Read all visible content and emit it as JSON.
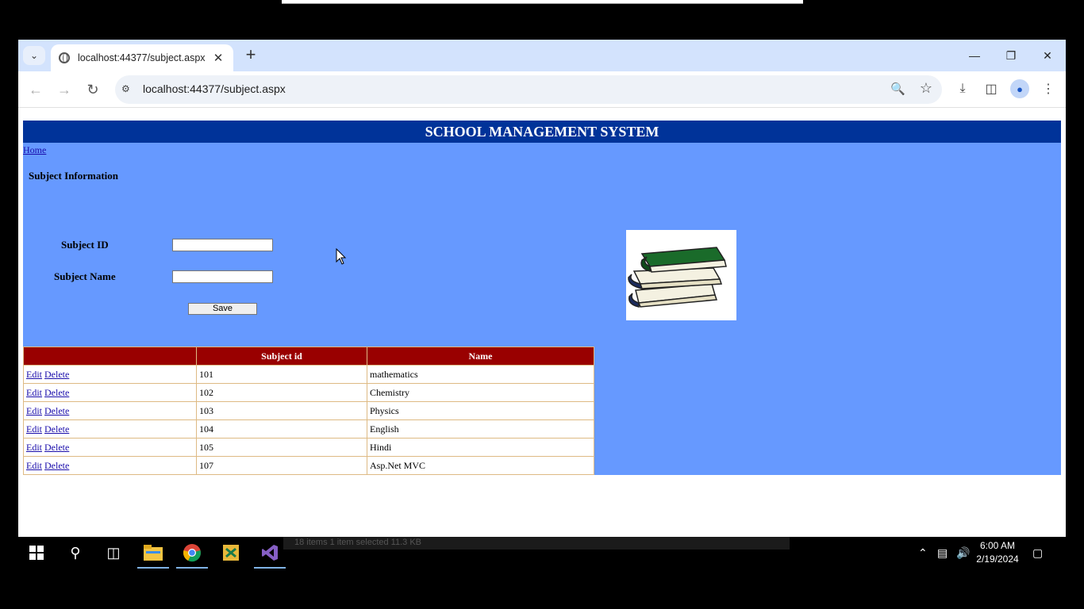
{
  "browser": {
    "tab_title": "localhost:44377/subject.aspx",
    "url": "localhost:44377/subject.aspx"
  },
  "page": {
    "header": "SCHOOL MANAGEMENT SYSTEM",
    "home_link": "Home",
    "section_title": "Subject Information",
    "form": {
      "subject_id_label": "Subject ID",
      "subject_id_value": "",
      "subject_name_label": "Subject Name",
      "subject_name_value": "",
      "save_label": "Save"
    },
    "table": {
      "headers": [
        "",
        "Subject id",
        "Name"
      ],
      "edit_label": "Edit",
      "delete_label": "Delete",
      "rows": [
        {
          "id": "101",
          "name": "mathematics"
        },
        {
          "id": "102",
          "name": "Chemistry"
        },
        {
          "id": "103",
          "name": "Physics"
        },
        {
          "id": "104",
          "name": "English"
        },
        {
          "id": "105",
          "name": "Hindi"
        },
        {
          "id": "107",
          "name": "Asp.Net MVC"
        }
      ]
    }
  },
  "taskbar": {
    "explorer_status": "18 items      1 item selected  11.3 KB",
    "time": "6:00 AM",
    "date": "2/19/2024"
  },
  "colors": {
    "header_bg": "#003399",
    "page_bg": "#6699ff",
    "grid_header_bg": "#990000"
  }
}
